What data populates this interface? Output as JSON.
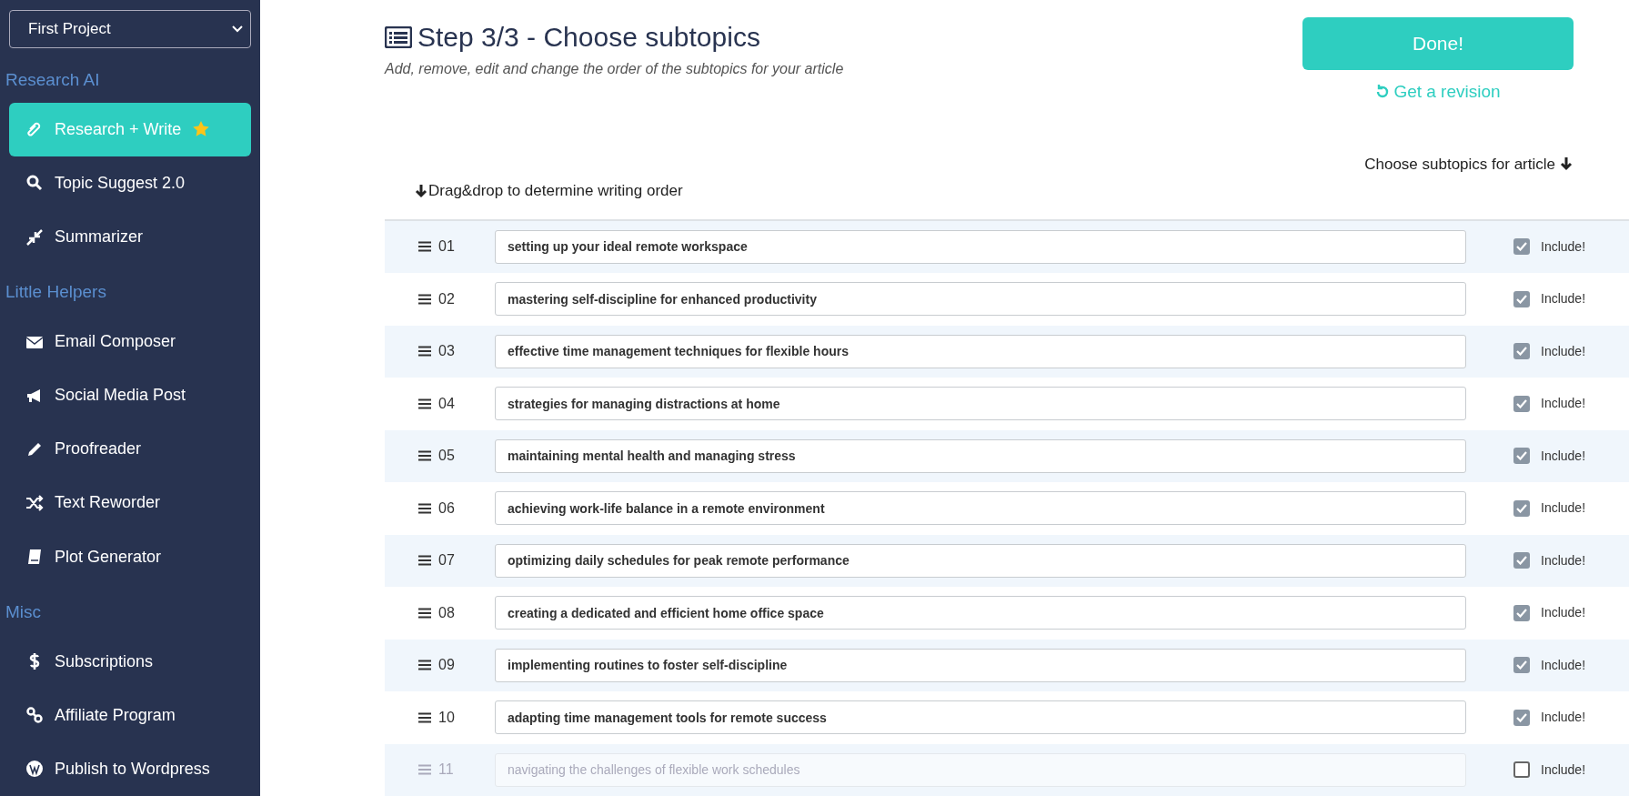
{
  "project_select": {
    "value": "First Project"
  },
  "sidebar": {
    "sections": [
      {
        "heading": "Research AI",
        "items": [
          {
            "label": "Research + Write",
            "kind": "paperclip",
            "selected": true,
            "starred": true
          },
          {
            "label": "Topic Suggest 2.0",
            "kind": "search",
            "selected": false,
            "starred": false
          },
          {
            "label": "Summarizer",
            "kind": "compress",
            "selected": false,
            "starred": false
          }
        ]
      },
      {
        "heading": "Little Helpers",
        "items": [
          {
            "label": "Email Composer",
            "kind": "envelope",
            "selected": false,
            "starred": false
          },
          {
            "label": "Social Media Post",
            "kind": "megaphone",
            "selected": false,
            "starred": false
          },
          {
            "label": "Proofreader",
            "kind": "pencil",
            "selected": false,
            "starred": false
          },
          {
            "label": "Text Reworder",
            "kind": "shuffle",
            "selected": false,
            "starred": false
          },
          {
            "label": "Plot Generator",
            "kind": "book",
            "selected": false,
            "starred": false
          }
        ]
      },
      {
        "heading": "Misc",
        "items": [
          {
            "label": "Subscriptions",
            "kind": "dollar",
            "selected": false,
            "starred": false
          },
          {
            "label": "Affiliate Program",
            "kind": "link",
            "selected": false,
            "starred": false
          },
          {
            "label": "Publish to Wordpress",
            "kind": "wordpress",
            "selected": false,
            "starred": false
          }
        ]
      }
    ]
  },
  "header": {
    "title": "Step 3/3 - Choose subtopics",
    "subtitle": "Add, remove, edit and change the order of the subtopics for your article",
    "done_button": "Done!",
    "revision_link": "Get a revision"
  },
  "table": {
    "choose_label": "Choose subtopics for article",
    "drag_label": "Drag&drop to determine writing order",
    "rows": [
      {
        "number": "01",
        "value": "setting up your ideal remote workspace",
        "include_label": "Include!",
        "checked": true
      },
      {
        "number": "02",
        "value": "mastering self-discipline for enhanced productivity",
        "include_label": "Include!",
        "checked": true
      },
      {
        "number": "03",
        "value": "effective time management techniques for flexible hours",
        "include_label": "Include!",
        "checked": true
      },
      {
        "number": "04",
        "value": "strategies for managing distractions at home",
        "include_label": "Include!",
        "checked": true
      },
      {
        "number": "05",
        "value": "maintaining mental health and managing stress",
        "include_label": "Include!",
        "checked": true
      },
      {
        "number": "06",
        "value": "achieving work-life balance in a remote environment",
        "include_label": "Include!",
        "checked": true
      },
      {
        "number": "07",
        "value": "optimizing daily schedules for peak remote performance",
        "include_label": "Include!",
        "checked": true
      },
      {
        "number": "08",
        "value": "creating a dedicated and efficient home office space",
        "include_label": "Include!",
        "checked": true
      },
      {
        "number": "09",
        "value": "implementing routines to foster self-discipline",
        "include_label": "Include!",
        "checked": true
      },
      {
        "number": "10",
        "value": "adapting time management tools for remote success",
        "include_label": "Include!",
        "checked": true
      },
      {
        "number": "11",
        "value": "navigating the challenges of flexible work schedules",
        "include_label": "Include!",
        "checked": false
      }
    ]
  }
}
